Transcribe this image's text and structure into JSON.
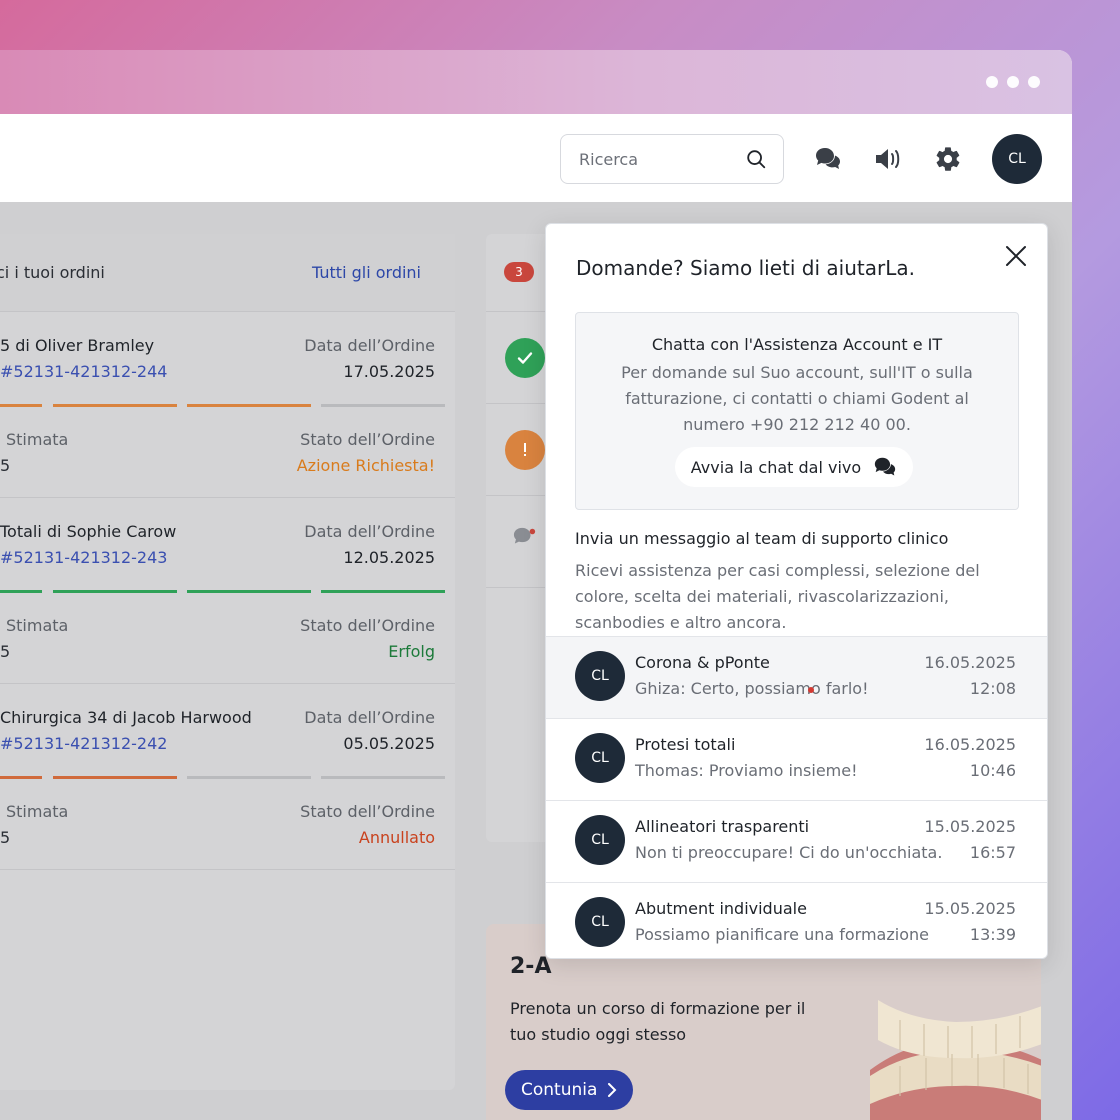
{
  "header": {
    "search_placeholder": "Ricerca",
    "avatar_initials": "CL"
  },
  "orders": {
    "title": "ci i tuoi ordini",
    "all_link": "Tutti gli ordini",
    "items": [
      {
        "name": "5 di Oliver Bramley",
        "number": "#52131-421312-244",
        "date_label": "Data dell’Ordine",
        "date": "17.05.2025",
        "estimate_label": "Stimata",
        "estimate_value": "5",
        "status_label": "Stato dell’Ordine",
        "status": "Azione Richiesta!",
        "status_color": "#d97b1c",
        "progress_color": "#d9833f",
        "progress_steps_done": 3,
        "progress_steps_total": 4
      },
      {
        "name": "Totali di Sophie Carow",
        "number": "#52131-421312-243",
        "date_label": "Data dell’Ordine",
        "date": "12.05.2025",
        "estimate_label": "Stimata",
        "estimate_value": "5",
        "status_label": "Stato dell’Ordine",
        "status": "Erfolg",
        "status_color": "#1c7a3a",
        "progress_color": "#2fa158",
        "progress_steps_done": 4,
        "progress_steps_total": 4
      },
      {
        "name": "Chirurgica 34 di Jacob Harwood",
        "number": "#52131-421312-242",
        "date_label": "Data dell’Ordine",
        "date": "05.05.2025",
        "estimate_label": "Stimata",
        "estimate_value": "5",
        "status_label": "Stato dell’Ordine",
        "status": "Annullato",
        "status_color": "#c9421e",
        "progress_color": "#d06a3c",
        "progress_steps_done": 2,
        "progress_steps_total": 4
      }
    ]
  },
  "notifications": {
    "badge_count": "3"
  },
  "promo": {
    "title": "2-A",
    "text": "Prenota un corso di formazione per il tuo studio oggi stesso",
    "button": "Contunia"
  },
  "help": {
    "title": "Domande? Siamo lieti di aiutarLa.",
    "chat_title": "Chatta con l'Assistenza Account e IT",
    "chat_desc": "Per domande sul Suo account, sull'IT o sulla fatturazione, ci contatti o chiami Godent al numero +90 212 212 40 00.",
    "live_button": "Avvia la chat dal vivo",
    "message_title": "Invia un messaggio al team di supporto clinico",
    "message_desc": "Ricevi assistenza per casi complessi, selezione del colore, scelta dei materiali, rivascolarizzazioni, scanbodies e altro ancora.",
    "threads": [
      {
        "initials": "CL",
        "name": "Corona & pPonte",
        "message": "Ghiza: Certo, possiamo farlo!",
        "date": "16.05.2025",
        "time": "12:08",
        "unread": true
      },
      {
        "initials": "CL",
        "name": "Protesi totali",
        "message": "Thomas: Proviamo insieme!",
        "date": "16.05.2025",
        "time": "10:46",
        "unread": false
      },
      {
        "initials": "CL",
        "name": "Allineatori trasparenti",
        "message": "Non ti preoccupare! Ci do un'occhiata.",
        "date": "15.05.2025",
        "time": "16:57",
        "unread": false
      },
      {
        "initials": "CL",
        "name": "Abutment individuale",
        "message": "Possiamo pianificare una formazione",
        "date": "15.05.2025",
        "time": "13:39",
        "unread": false
      }
    ]
  }
}
